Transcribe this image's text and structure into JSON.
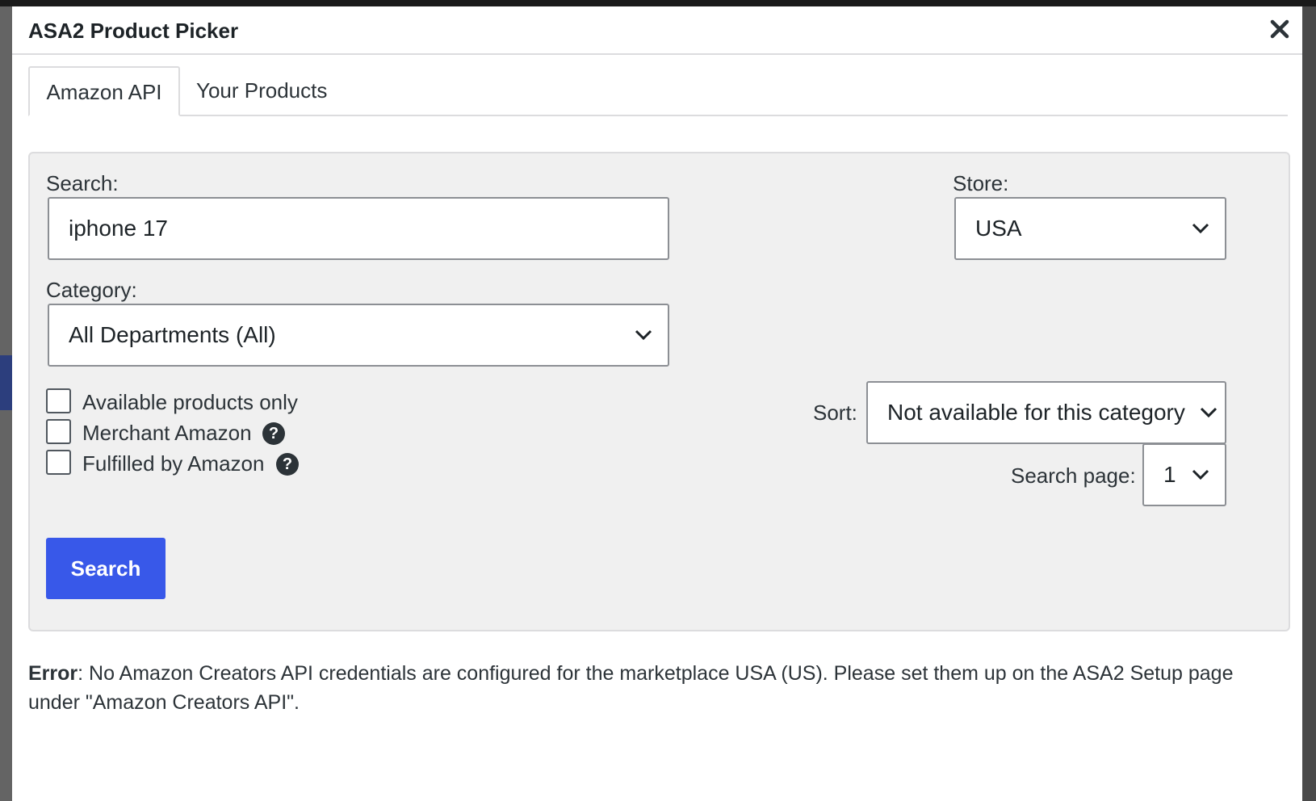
{
  "modal": {
    "title": "ASA2 Product Picker",
    "close_icon": "close-icon"
  },
  "tabs": [
    {
      "label": "Amazon API",
      "active": true
    },
    {
      "label": "Your Products",
      "active": false
    }
  ],
  "form": {
    "search_label": "Search:",
    "search_value": "iphone 17",
    "store_label": "Store:",
    "store_value": "USA",
    "category_label": "Category:",
    "category_value": "All Departments (All)",
    "checkboxes": [
      {
        "label": "Available products only",
        "checked": false,
        "help": false
      },
      {
        "label": "Merchant Amazon",
        "checked": false,
        "help": true
      },
      {
        "label": "Fulfilled by Amazon",
        "checked": false,
        "help": true
      }
    ],
    "help_glyph": "?",
    "sort_label": "Sort:",
    "sort_value": "Not available for this category",
    "page_label": "Search page:",
    "page_value": "1",
    "search_button": "Search"
  },
  "error": {
    "prefix": "Error",
    "message": ": No Amazon Creators API credentials are configured for the marketplace USA (US). Please set them up on the ASA2 Setup page under \"Amazon Creators API\"."
  },
  "colors": {
    "accent": "#3858e9",
    "panel_bg": "#f0f0f0",
    "border": "#8c8f94",
    "text": "#1d2327"
  }
}
